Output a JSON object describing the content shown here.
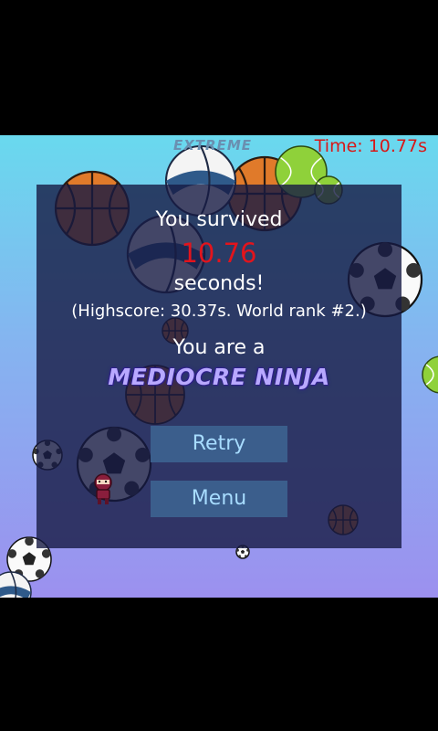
{
  "hud": {
    "difficulty": "EXTREME",
    "timer": "Time: 10.77s"
  },
  "result": {
    "survived_label": "You survived",
    "time_value": "10.76",
    "seconds_label": "seconds!",
    "highscore_text": "(Highscore: 30.37s. World rank #2.)",
    "you_are_label": "You are a",
    "rank_title": "MEDIOCRE NINJA"
  },
  "buttons": {
    "retry": "Retry",
    "menu": "Menu"
  },
  "colors": {
    "timer": "#d81818",
    "time_value": "#e3141c",
    "button_bg": "#3b5e8c",
    "button_text": "#a7dcff",
    "panel": "#161a44"
  },
  "balls": [
    {
      "type": "basketball"
    },
    {
      "type": "basketball"
    },
    {
      "type": "tennis"
    },
    {
      "type": "volleyball"
    },
    {
      "type": "volleyball"
    },
    {
      "type": "basketball"
    },
    {
      "type": "soccer"
    },
    {
      "type": "soccer"
    },
    {
      "type": "soccer"
    },
    {
      "type": "soccer"
    },
    {
      "type": "basketball"
    },
    {
      "type": "basketball"
    },
    {
      "type": "tennis"
    },
    {
      "type": "tennis"
    },
    {
      "type": "volleyball"
    },
    {
      "type": "soccer"
    }
  ]
}
